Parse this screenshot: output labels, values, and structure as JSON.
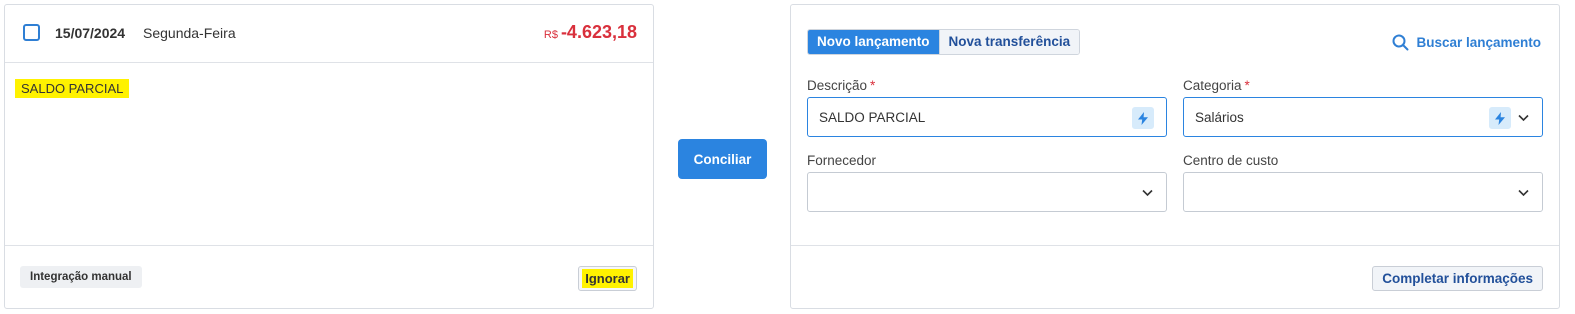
{
  "transaction": {
    "date": "15/07/2024",
    "weekday": "Segunda-Feira",
    "currency": "R$",
    "amount": "-4.623,18",
    "amount_color": "#d9303c",
    "description": "SALDO PARCIAL",
    "source_tag": "Integração manual",
    "ignore_label": "Ignorar"
  },
  "action": {
    "reconcile_label": "Conciliar",
    "accent": "#2b84e0"
  },
  "entry_form": {
    "tabs": [
      {
        "label": "Novo lançamento",
        "active": true
      },
      {
        "label": "Nova transferência",
        "active": false
      }
    ],
    "search_label": "Buscar lançamento",
    "description": {
      "label": "Descrição",
      "required": "*",
      "value": "SALDO PARCIAL"
    },
    "category": {
      "label": "Categoria",
      "required": "*",
      "value": "Salários"
    },
    "supplier": {
      "label": "Fornecedor",
      "value": ""
    },
    "cost_center": {
      "label": "Centro de custo",
      "value": ""
    },
    "complete_label": "Completar informações"
  },
  "icons": {
    "checkbox": "checkbox-icon",
    "search": "search-icon",
    "suggestion": "lightning-icon",
    "dropdown": "chevron-down-icon"
  }
}
